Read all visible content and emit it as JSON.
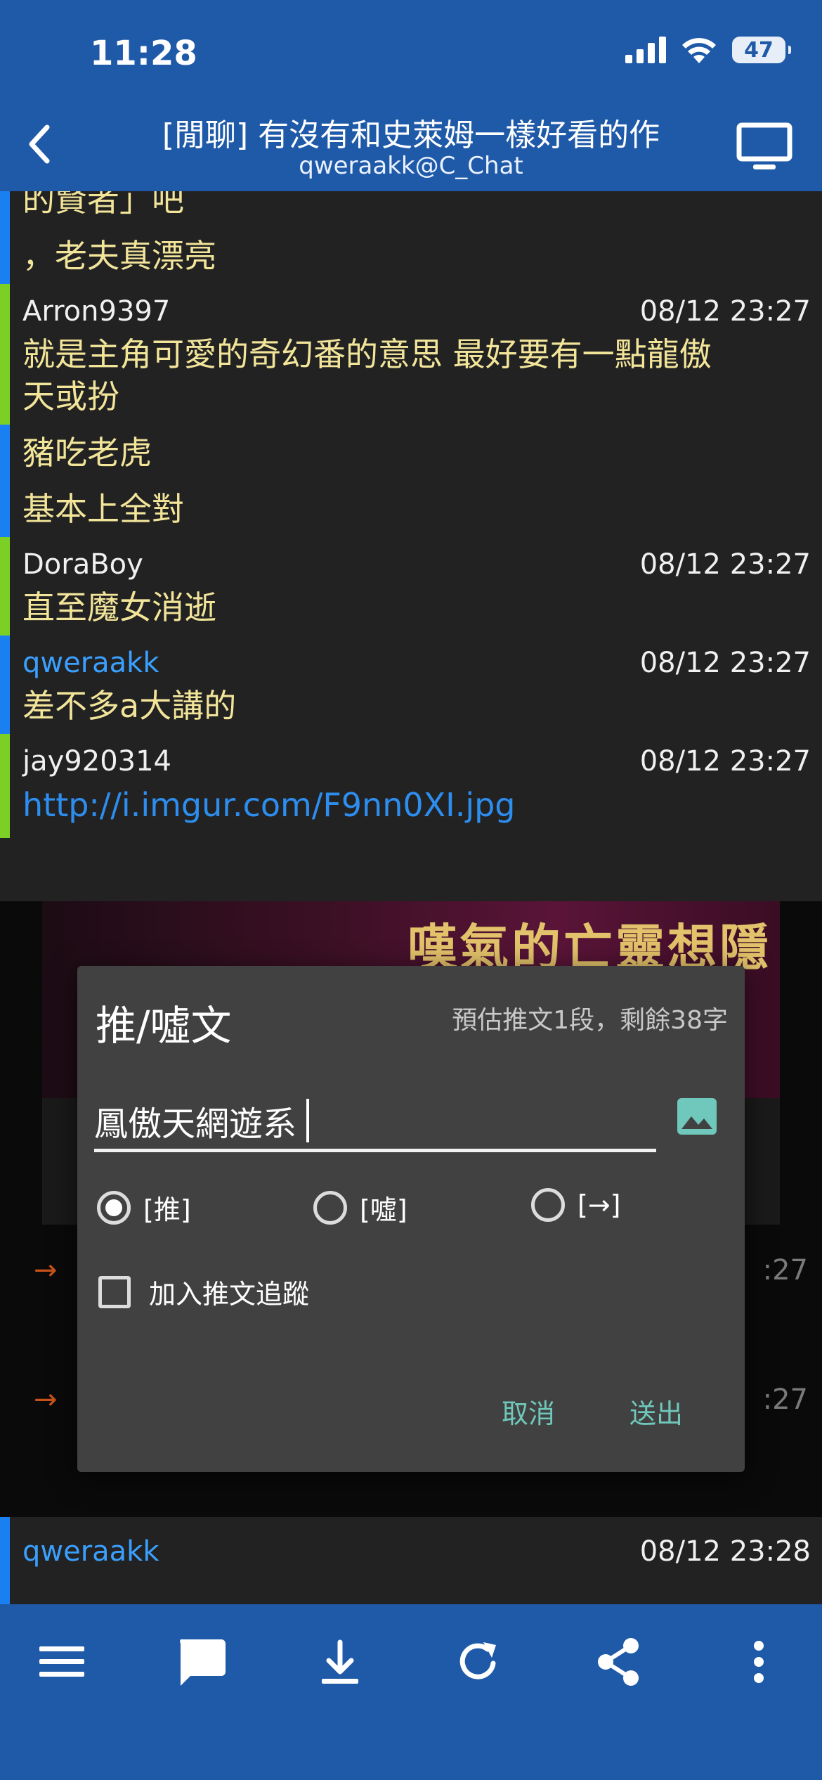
{
  "status_bar": {
    "time": "11:28",
    "battery": "47"
  },
  "nav": {
    "title": "[閒聊] 有沒有和史萊姆一樣好看的作",
    "subtitle": "qweraakk@C_Chat"
  },
  "posts": [
    {
      "lines": [
        "的賢者」吧"
      ]
    },
    {
      "lines": [
        "，老夫真漂亮"
      ]
    },
    {
      "user": "Arron9397",
      "date": "08/12 23:27",
      "lines": [
        "就是主角可愛的奇幻番的意思 最好要有一點龍傲",
        "天或扮"
      ]
    },
    {
      "lines": [
        "豬吃老虎"
      ]
    },
    {
      "lines": [
        "基本上全對"
      ]
    },
    {
      "user": "DoraBoy",
      "date": "08/12 23:27",
      "lines": [
        "直至魔女消逝"
      ]
    },
    {
      "user": "qweraakk",
      "date": "08/12 23:27",
      "lines": [
        "差不多a大講的"
      ]
    },
    {
      "user": "jay920314",
      "date": "08/12 23:27",
      "link": "http://i.imgur.com/F9nn0XI.jpg"
    }
  ],
  "background": {
    "banner_text": "嘆氣的亡靈想隱退",
    "arrow": "→",
    "time_frag_1": ":27",
    "time_frag_2": ":27"
  },
  "bottom_post": {
    "user": "qweraakk",
    "date": "08/12 23:28"
  },
  "dialog": {
    "title": "推/噓文",
    "hint": "預估推文1段，剩餘38字",
    "input_value": "鳳傲天網遊系",
    "options": [
      "[推]",
      "[噓]",
      "[→]"
    ],
    "selected_option": "[推]",
    "checkbox_label": "加入推文追蹤",
    "checkbox_checked": false,
    "cancel": "取消",
    "submit": "送出"
  },
  "toolbar": {
    "icons": [
      "menu-icon",
      "comment-icon",
      "download-icon",
      "refresh-icon",
      "share-icon",
      "more-icon"
    ]
  },
  "colors": {
    "bar": "#1f5aa8",
    "content_bg": "#222222",
    "push_text": "#f2e59a",
    "accent_teal": "#6fc8bb",
    "link": "#2d8ef0"
  }
}
